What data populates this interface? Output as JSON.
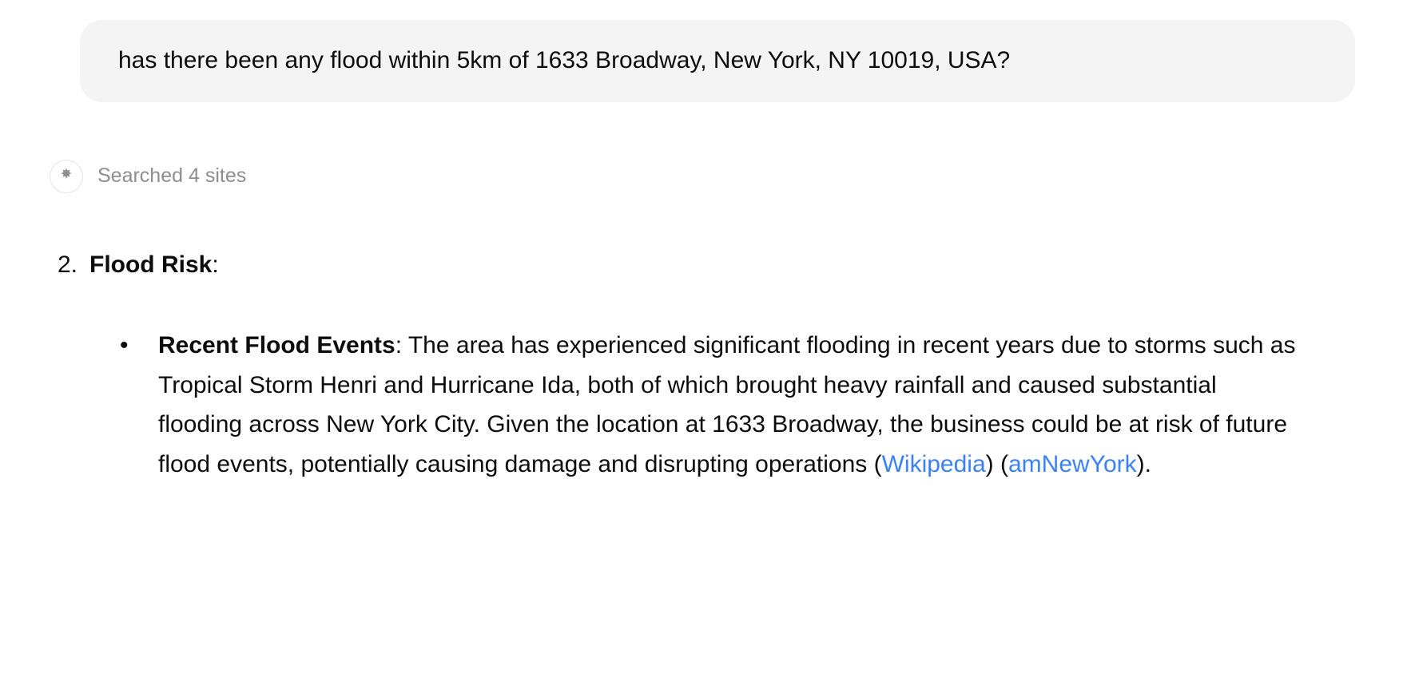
{
  "user_message": {
    "text": "has there been any flood within 5km of 1633 Broadway, New York, NY 10019, USA?"
  },
  "search_status": {
    "text": "Searched 4 sites"
  },
  "answer": {
    "number": "2.",
    "heading": "Flood Risk",
    "heading_suffix": ":",
    "bullet": {
      "label": "Recent Flood Events",
      "label_suffix": ": ",
      "body": "The area has experienced significant flooding in recent years due to storms such as Tropical Storm Henri and Hurricane Ida, both of which brought heavy rainfall and caused substantial flooding across New York City. Given the location at 1633 Broadway, the business could be at risk of future flood events, potentially causing damage and disrupting operations ",
      "sources": [
        {
          "label": "Wikipedia"
        },
        {
          "label": "amNewYork"
        }
      ],
      "trailing": "."
    }
  }
}
